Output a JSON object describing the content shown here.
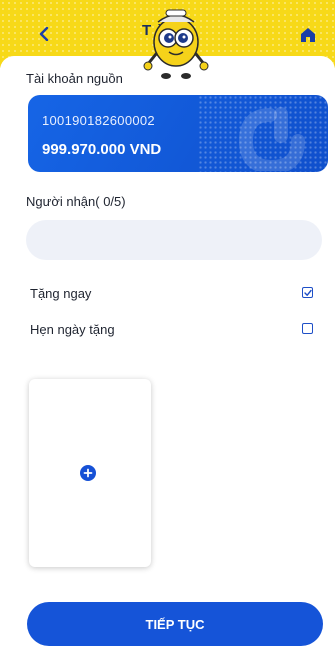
{
  "header": {
    "title": "T          à",
    "back_icon": "chevron-left-icon",
    "home_icon": "home-icon"
  },
  "source_account": {
    "label": "Tài khoản nguồn",
    "account_number": "100190182600002",
    "balance": "999.970.000 VND"
  },
  "recipient": {
    "label": "Người nhận( 0/5)",
    "input_value": "",
    "input_placeholder": ""
  },
  "options": [
    {
      "label": "Tặng ngay",
      "checked": true
    },
    {
      "label": "Hẹn ngày tặng",
      "checked": false
    }
  ],
  "card_slot": {
    "icon": "plus-circle-icon"
  },
  "continue_button": {
    "label": "TIẾP TỤC"
  },
  "colors": {
    "header_yellow": "#f7d918",
    "primary_blue": "#1554d8",
    "input_bg": "#eef1f8"
  }
}
